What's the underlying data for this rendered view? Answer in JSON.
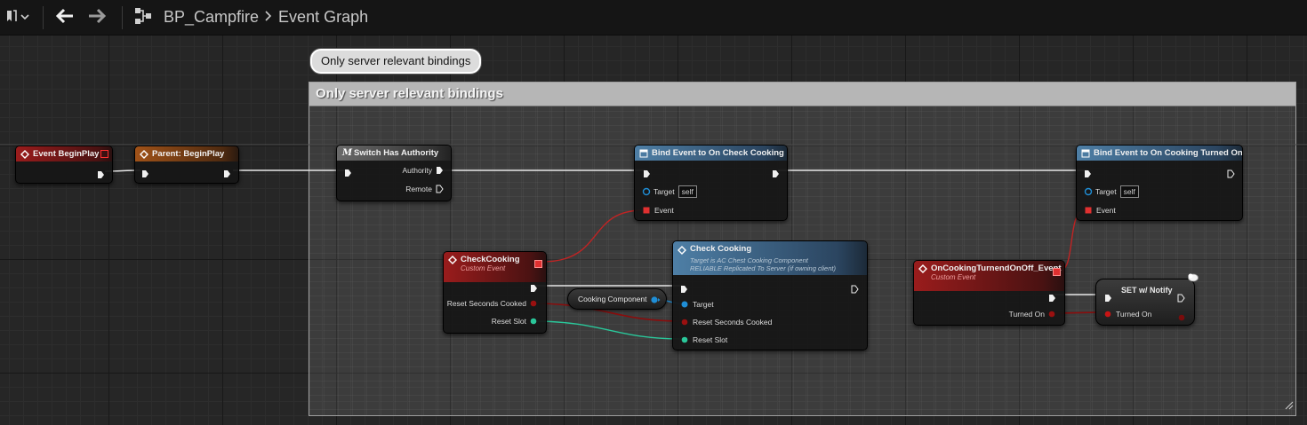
{
  "toolbar": {
    "breadcrumb_blueprint": "BP_Campfire",
    "breadcrumb_graph": "Event Graph"
  },
  "comment": {
    "bubble": "Only server relevant bindings",
    "title": "Only server relevant bindings"
  },
  "nodes": {
    "event_begin_play": {
      "title": "Event BeginPlay"
    },
    "parent_begin_play": {
      "title": "Parent: BeginPlay"
    },
    "switch_authority": {
      "title": "Switch Has Authority",
      "pin_authority": "Authority",
      "pin_remote": "Remote"
    },
    "bind_check_cooking": {
      "title": "Bind Event to On Check Cooking",
      "pin_target": "Target",
      "target_value": "self",
      "pin_event": "Event"
    },
    "bind_cooking_turned_on": {
      "title": "Bind Event to On Cooking Turned On",
      "pin_target": "Target",
      "target_value": "self",
      "pin_event": "Event"
    },
    "check_cooking_event": {
      "title": "CheckCooking",
      "subtitle": "Custom Event",
      "pin_reset_seconds": "Reset Seconds Cooked",
      "pin_reset_slot": "Reset Slot"
    },
    "cooking_component": {
      "title": "Cooking Component"
    },
    "check_cooking_call": {
      "title": "Check Cooking",
      "subtitle_1": "Target is AC Chest Cooking Component",
      "subtitle_2": "RELIABLE Replicated To Server (if owning client)",
      "pin_target": "Target",
      "pin_reset_seconds": "Reset Seconds Cooked",
      "pin_reset_slot": "Reset Slot"
    },
    "on_cooking_event": {
      "title": "OnCookingTurnendOnOff_Event",
      "subtitle": "Custom Event",
      "pin_turned_on": "Turned On"
    },
    "set_notify": {
      "title": "SET w/ Notify",
      "pin_turned_on": "Turned On"
    }
  },
  "colors": {
    "exec_wire": "#e8e8e8",
    "delegate_wire": "#c02424",
    "object_wire": "#1f8ed6",
    "bool_wire": "#8a0d0d",
    "struct_wire": "#2ac79a",
    "event_header": "#9a1c1c",
    "parent_header": "#a05218",
    "function_header": "#4e7fa6"
  }
}
